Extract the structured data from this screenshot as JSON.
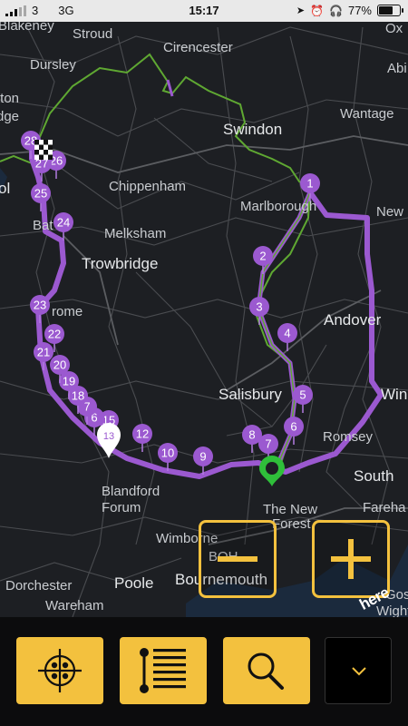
{
  "status_bar": {
    "carrier_signal": "3",
    "network": "3G",
    "time": "15:17",
    "battery_percent": "77%",
    "battery_level": 0.77
  },
  "map": {
    "places": [
      {
        "name": "Blakeney",
        "big": false
      },
      {
        "name": "Stroud",
        "big": false
      },
      {
        "name": "Cirencester",
        "big": false
      },
      {
        "name": "Dursley",
        "big": false
      },
      {
        "name": "Abi",
        "big": false
      },
      {
        "name": "tton",
        "big": false
      },
      {
        "name": "dge",
        "big": false
      },
      {
        "name": "Wantage",
        "big": false
      },
      {
        "name": "Swindon",
        "big": true
      },
      {
        "name": "ol",
        "big": true
      },
      {
        "name": "Chippenham",
        "big": false
      },
      {
        "name": "Marlborough",
        "big": false
      },
      {
        "name": "New",
        "big": false
      },
      {
        "name": "Bat",
        "big": false
      },
      {
        "name": "Melksham",
        "big": false
      },
      {
        "name": "Trowbridge",
        "big": false
      },
      {
        "name": "Andover",
        "big": false
      },
      {
        "name": "rome",
        "big": false
      },
      {
        "name": "Salisbury",
        "big": true
      },
      {
        "name": "Win",
        "big": false
      },
      {
        "name": "Romsey",
        "big": false
      },
      {
        "name": "South",
        "big": true
      },
      {
        "name": "Blandford",
        "big": false
      },
      {
        "name": "Forum",
        "big": false
      },
      {
        "name": "The New",
        "big": false
      },
      {
        "name": "Forest",
        "big": false
      },
      {
        "name": "Fareha",
        "big": false
      },
      {
        "name": "Wimborne",
        "big": false
      },
      {
        "name": "BOH",
        "big": false
      },
      {
        "name": "Bournemouth",
        "big": true
      },
      {
        "name": "Dorchester",
        "big": false
      },
      {
        "name": "Poole",
        "big": true
      },
      {
        "name": "Wareham",
        "big": false
      },
      {
        "name": "Gosp",
        "big": false
      },
      {
        "name": "Wight",
        "big": false
      },
      {
        "name": "Ox",
        "big": false
      }
    ],
    "waypoints": [
      "1",
      "2",
      "3",
      "4",
      "5",
      "6",
      "7",
      "8",
      "9",
      "10",
      "12",
      "15",
      "6",
      "7",
      "18",
      "19",
      "20",
      "21",
      "22",
      "23",
      "24",
      "25",
      "26",
      "27",
      "28"
    ],
    "route_color": "#9b59d0",
    "alt_route_color": "#5fa832",
    "start_marker": "green-pin-icon",
    "current_marker": "white-pin-icon",
    "finish_marker": "checkered-flag-icon",
    "current_marker_number": "13",
    "attribution": "here"
  },
  "zoom_controls": {
    "zoom_out": "minus-icon",
    "zoom_in": "plus-icon",
    "accent": "#f3c13e"
  },
  "toolbar": {
    "buttons": [
      {
        "name": "locate-button",
        "icon": "crosshair-icon"
      },
      {
        "name": "route-list-button",
        "icon": "route-list-icon"
      },
      {
        "name": "search-button",
        "icon": "search-icon"
      },
      {
        "name": "more-button",
        "icon": "chevron-down-icon"
      }
    ],
    "accent": "#f3c13e"
  }
}
